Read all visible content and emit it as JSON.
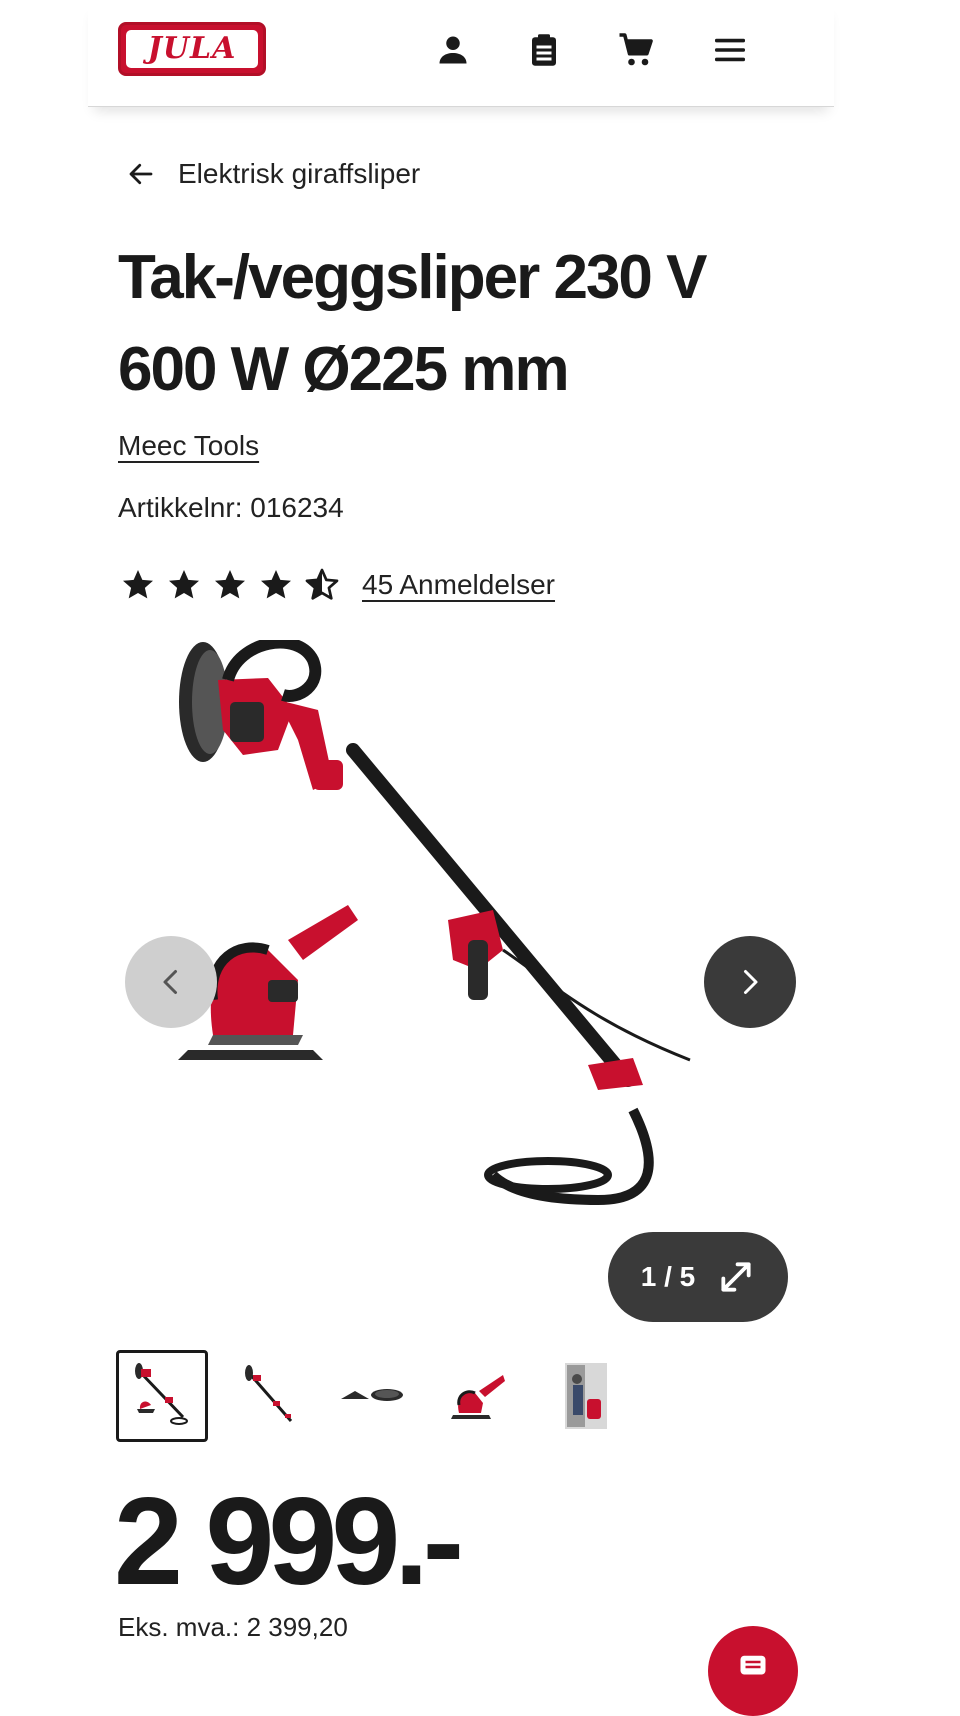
{
  "header": {
    "logo_text": "JULA",
    "icons": [
      "account-icon",
      "shopping-list-icon",
      "cart-icon",
      "menu-icon"
    ]
  },
  "breadcrumb": {
    "label": "Elektrisk giraffsliper"
  },
  "product": {
    "title_line1": "Tak-/veggsliper 230 V",
    "title_line2": "600 W Ø225 mm",
    "brand": "Meec Tools",
    "sku_text": "Artikkelnr: 016234",
    "rating": 4.5,
    "rating_max": 5,
    "reviews_label": "45 Anmeldelser"
  },
  "gallery": {
    "counter": "1 / 5",
    "current": 1,
    "total": 5,
    "thumbnails": [
      "thumbnail-sander-full",
      "thumbnail-sander-angle",
      "thumbnail-sanding-pads",
      "thumbnail-sander-head",
      "thumbnail-sander-in-use"
    ]
  },
  "pricing": {
    "price": "2 999.-",
    "ex_vat": "Eks. mva.: 2 399,20"
  },
  "colors": {
    "brand_red": "#c8102e",
    "text_dark": "#1a1a1a",
    "nav_dark": "#3a3a3a",
    "nav_light": "#cfcfcf"
  }
}
